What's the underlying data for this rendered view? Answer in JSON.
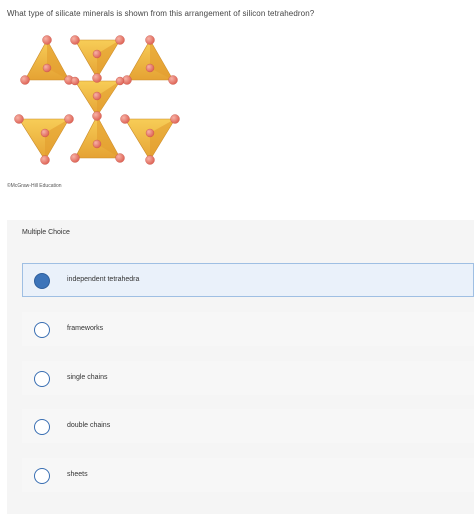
{
  "question": {
    "text": "What type of silicate minerals is shown from this arrangement of silicon tetrahedron?"
  },
  "figure": {
    "credit": "©McGraw-Hill Education",
    "colors": {
      "tetra_light": "#f6c445",
      "tetra_mid": "#e9a733",
      "tetra_dark": "#c98a2a",
      "oxygen": "#e8766a",
      "oxygen_highlight": "#f4a79a"
    }
  },
  "multiple_choice": {
    "header": "Multiple Choice",
    "selected_index": 0,
    "options": [
      {
        "label": "independent tetrahedra"
      },
      {
        "label": "frameworks"
      },
      {
        "label": "single chains"
      },
      {
        "label": "double chains"
      },
      {
        "label": "sheets"
      }
    ]
  },
  "colors": {
    "accent": "#3d74b9",
    "selected_bg": "#eaf1fa",
    "panel_bg": "#f5f5f5"
  }
}
